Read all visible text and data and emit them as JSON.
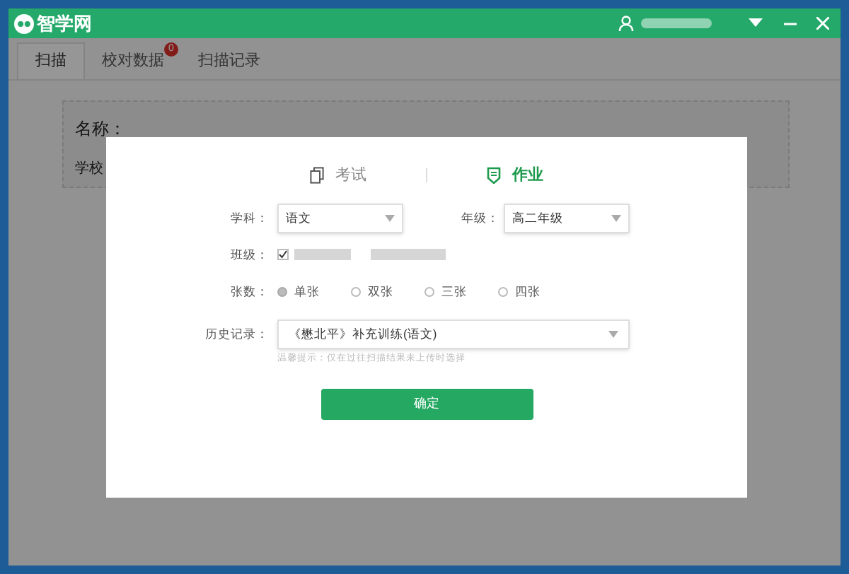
{
  "window": {
    "title": "智学网"
  },
  "tabs": [
    {
      "label": "扫描",
      "selected": true
    },
    {
      "label": "校对数据",
      "selected": false,
      "badge": "0"
    },
    {
      "label": "扫描记录",
      "selected": false
    }
  ],
  "background_card": {
    "name_label": "名称：",
    "school_label": "学校"
  },
  "dialog": {
    "modes": [
      {
        "label": "考试",
        "selected": false,
        "kind": "exam"
      },
      {
        "label": "作业",
        "selected": true,
        "kind": "homework"
      }
    ],
    "subject": {
      "label": "学科：",
      "value": "语文"
    },
    "grade": {
      "label": "年级：",
      "value": "高二年级"
    },
    "class": {
      "label": "班级：",
      "checked": true
    },
    "sheets": {
      "label": "张数：",
      "options": [
        {
          "label": "单张",
          "selected": true
        },
        {
          "label": "双张",
          "selected": false
        },
        {
          "label": "三张",
          "selected": false
        },
        {
          "label": "四张",
          "selected": false
        }
      ]
    },
    "history": {
      "label": "历史记录：",
      "value": "《懋北平》补充训练(语文)",
      "hint": "温馨提示：仅在过往扫描结果未上传时选择"
    },
    "confirm": "确定"
  }
}
